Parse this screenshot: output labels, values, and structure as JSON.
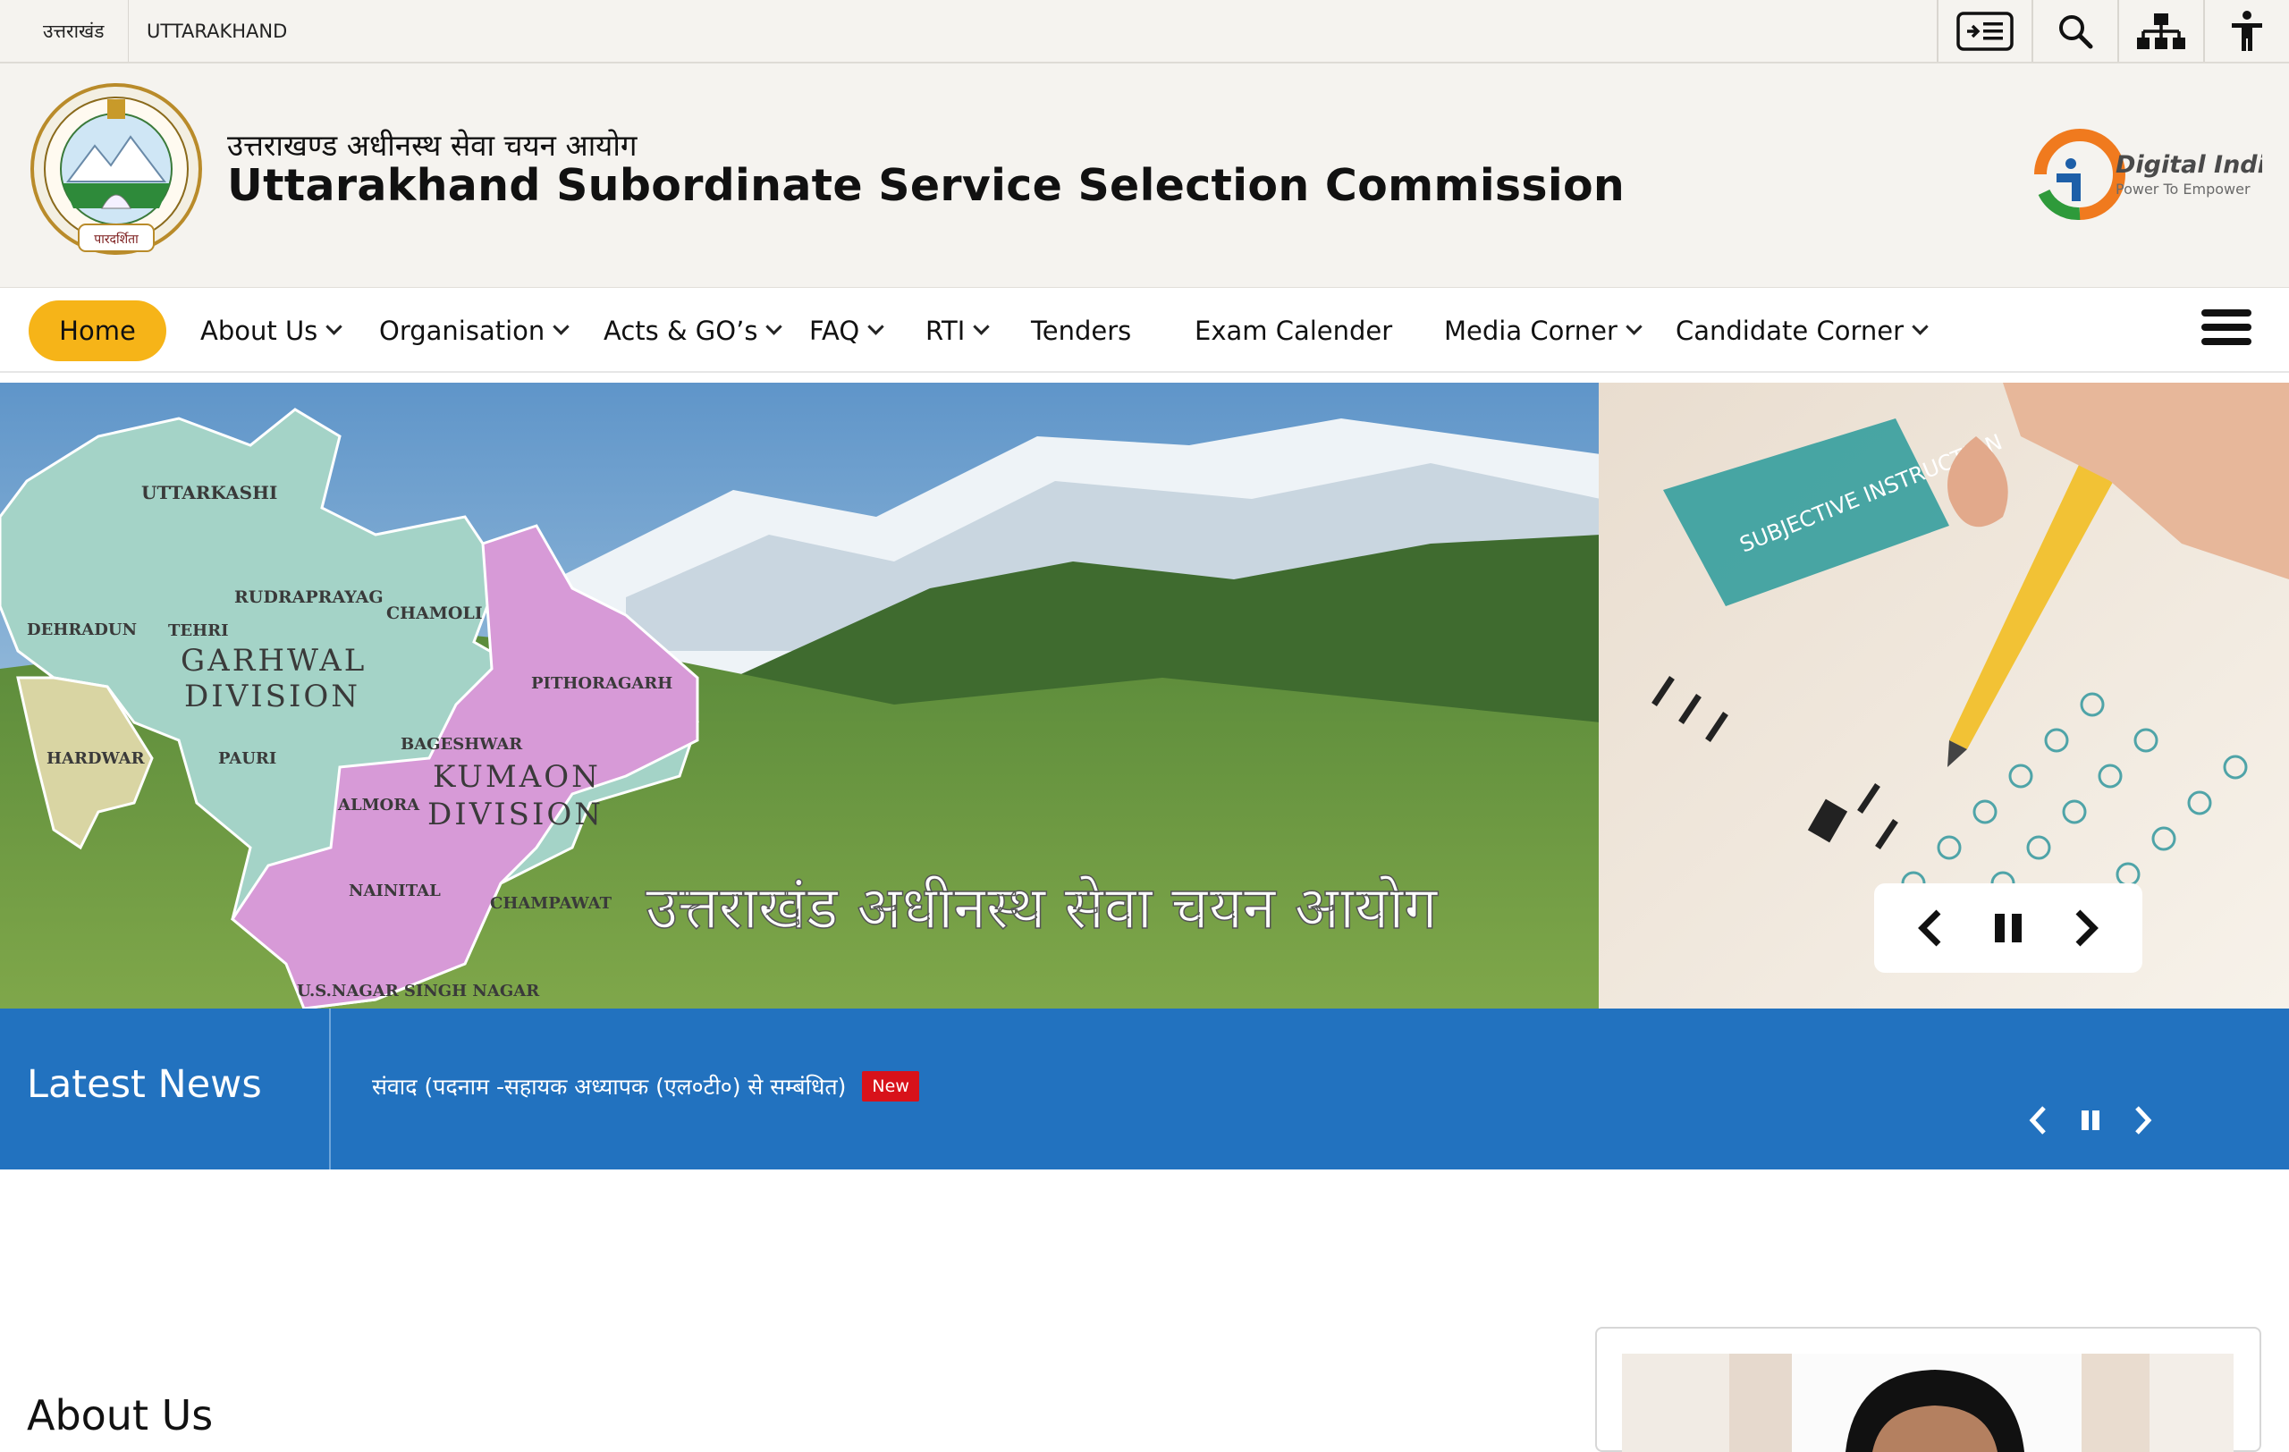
{
  "topbar": {
    "lang_hindi": "उत्तराखंड",
    "lang_english": "UTTARAKHAND",
    "tools": [
      "skip-to-content-icon",
      "search-icon",
      "sitemap-icon",
      "accessibility-icon"
    ]
  },
  "header": {
    "title_hindi": "उत्तराखण्ड अधीनस्थ सेवा चयन आयोग",
    "title_english": "Uttarakhand Subordinate Service Selection Commission",
    "emblem_motto": "पारदर्शिता",
    "digital_india_title": "Digital India",
    "digital_india_tagline": "Power To Empower"
  },
  "nav": {
    "items": [
      {
        "label": "Home",
        "active": true
      },
      {
        "label": "About Us",
        "dropdown": true
      },
      {
        "label": "Organisation",
        "dropdown": true
      },
      {
        "label": "Acts & GO’s",
        "dropdown": true
      },
      {
        "label": "FAQ",
        "dropdown": true
      },
      {
        "label": "RTI",
        "dropdown": true
      },
      {
        "label": "Tenders",
        "dropdown": false
      },
      {
        "label": "Exam Calender",
        "dropdown": false
      },
      {
        "label": "Media Corner",
        "dropdown": true
      },
      {
        "label": "Candidate Corner",
        "dropdown": true
      }
    ]
  },
  "banner": {
    "caption": "उत्तराखंड अधीनस्थ सेवा चयन आयोग",
    "map_labels": {
      "uttarkashi": "UTTARKASHI",
      "rudraprayag": "RUDRAPRAYAG",
      "chamoli": "CHAMOLI",
      "dehradun": "DEHRADUN",
      "tehri": "TEHRI",
      "garhwal1": "GARHWAL",
      "garhwal2": "DIVISION",
      "hardwar": "HARDWAR",
      "pauri": "PAURI",
      "pithoragarh": "PITHORAGARH",
      "bageshwar": "BAGESHWAR",
      "kumaon1": "KUMAON",
      "kumaon2": "DIVISION",
      "almora": "ALMORA",
      "nainital": "NAINITAL",
      "champawat": "CHAMPAWAT",
      "usnagar": "U.S.NAGAR SINGH NAGAR"
    },
    "sheet_text": "SUBJECTIVE INSTRUCTION"
  },
  "news": {
    "label": "Latest News",
    "item": "संवाद (पदनाम -सहायक अध्यापक (एल०टी०) से सम्बंधित)",
    "badge": "New"
  },
  "about": {
    "title": "About Us"
  },
  "colors": {
    "accent": "#f6b418",
    "news_bg": "#2272bf",
    "badge": "#d8121a",
    "header_bg": "#f5f3ef"
  }
}
